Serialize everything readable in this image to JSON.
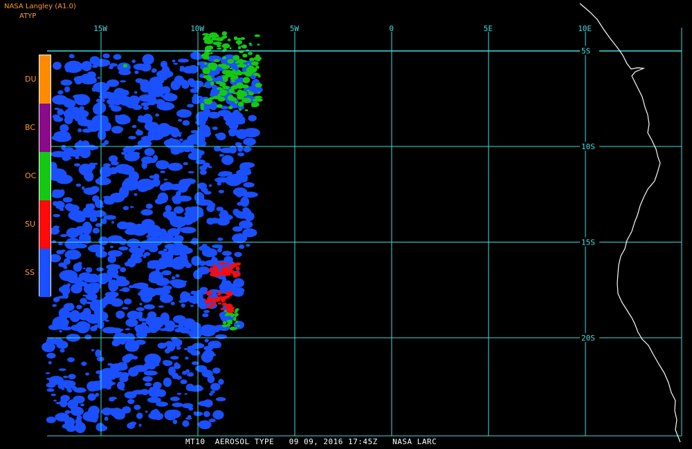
{
  "header": {
    "title": "NASA Langley (A1.0)",
    "product": "ATYP"
  },
  "map": {
    "longitude_labels": [
      {
        "label": "15W",
        "lon": -15
      },
      {
        "label": "10W",
        "lon": -10
      },
      {
        "label": "5W",
        "lon": -5
      },
      {
        "label": "0",
        "lon": 0
      },
      {
        "label": "5E",
        "lon": 5
      },
      {
        "label": "10E",
        "lon": 10
      }
    ],
    "latitude_labels": [
      {
        "label": "5S",
        "lat": -5
      },
      {
        "label": "10S",
        "lat": -10
      },
      {
        "label": "15S",
        "lat": -15
      },
      {
        "label": "20S",
        "lat": -20
      }
    ],
    "grid_color": "#3fe0e0",
    "coastline_color": "#ffffff"
  },
  "legend": {
    "items": [
      {
        "code": "DU",
        "color": "#ff8c00"
      },
      {
        "code": "BC",
        "color": "#8a0a8a"
      },
      {
        "code": "OC",
        "color": "#14c814"
      },
      {
        "code": "SU",
        "color": "#ff0a0a"
      },
      {
        "code": "SS",
        "color": "#1a50ff"
      }
    ]
  },
  "caption": "MT10  AEROSOL TYPE   09 09, 2016 17:45Z   NASA LARC"
}
